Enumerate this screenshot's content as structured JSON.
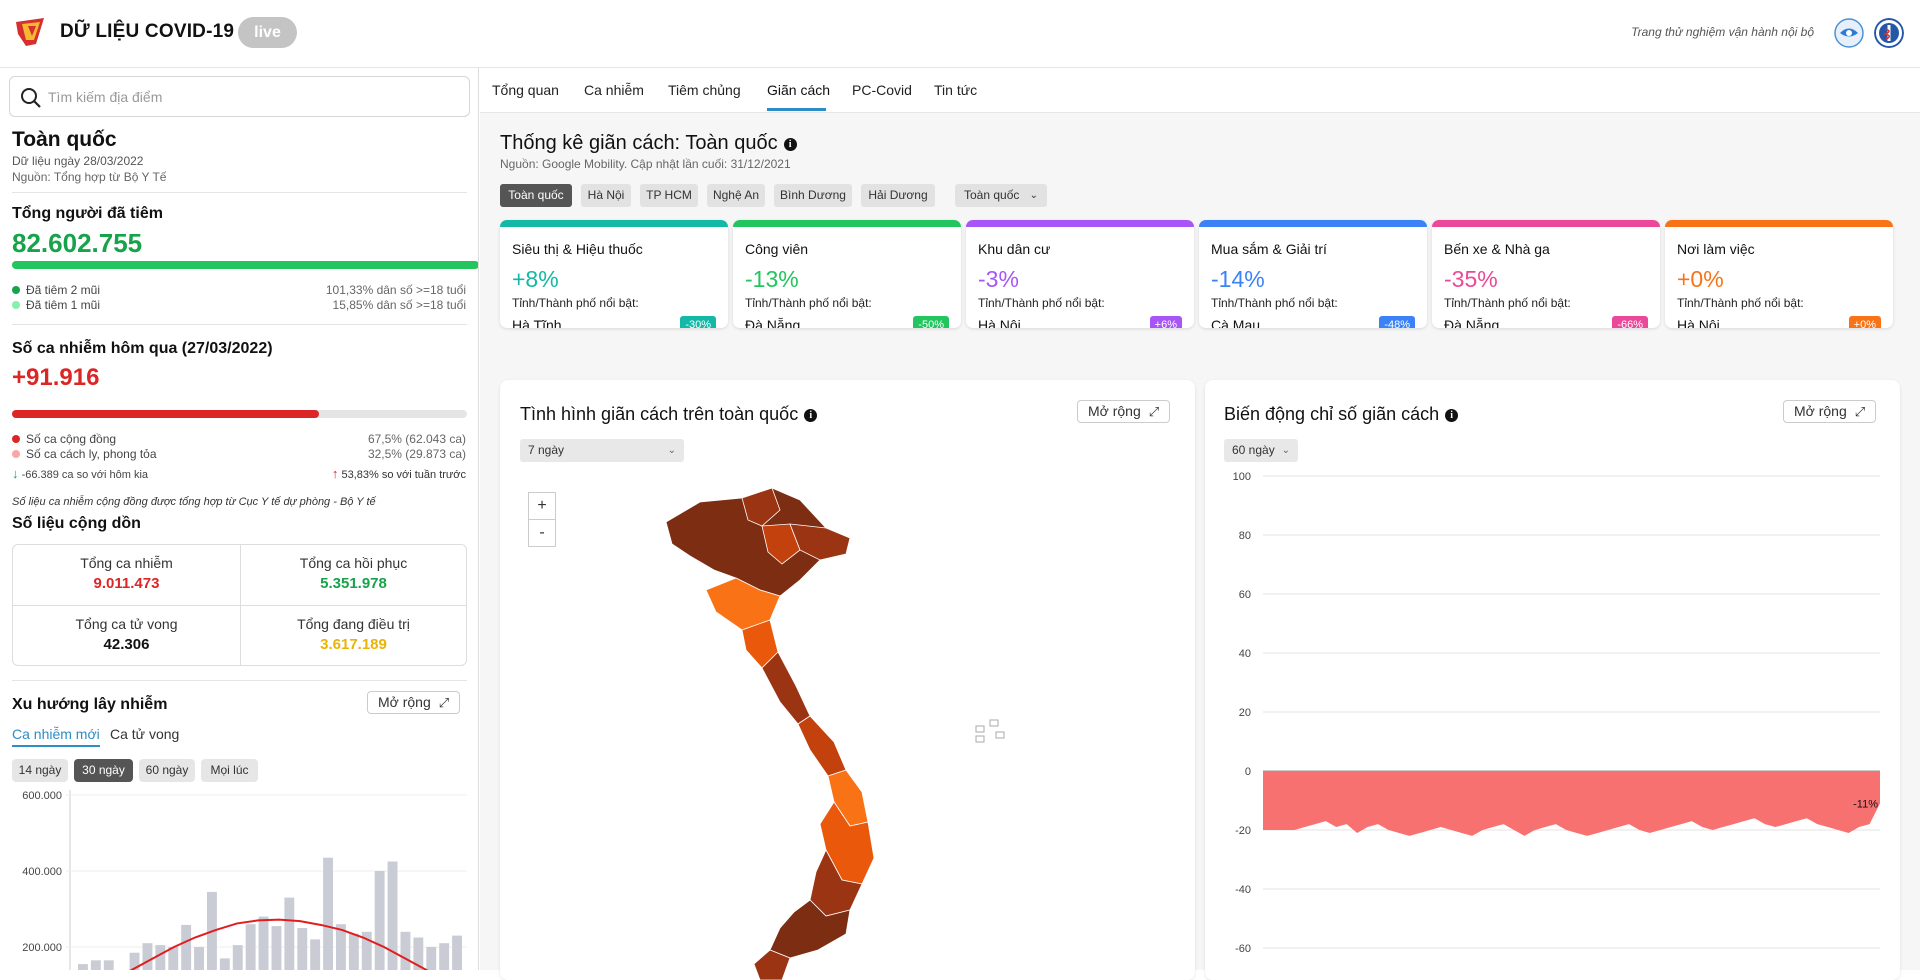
{
  "app": {
    "title": "DỮ LIỆU COVID-19",
    "live": "live",
    "notice": "Trang thử nghiệm vận hành nội bộ"
  },
  "sidebar": {
    "search_placeholder": "Tìm kiếm địa điểm",
    "region": "Toàn quốc",
    "data_date": "Dữ liệu ngày 28/03/2022",
    "data_source": "Nguồn: Tổng hợp từ Bộ Y Tế",
    "vax": {
      "title": "Tổng người đã tiêm",
      "value": "82.602.755",
      "dose2_label": "Đã tiêm 2 mũi",
      "dose2_value": "101,33% dân số >=18 tuổi",
      "dose1_label": "Đã tiêm 1 mũi",
      "dose1_value": "15,85% dân số >=18 tuổi",
      "progress": 1.0
    },
    "cases": {
      "title": "Số ca nhiễm hôm qua (27/03/2022)",
      "value": "+91.916",
      "progress": 0.675,
      "community_label": "Số ca cộng đồng",
      "community_value": "67,5% (62.043 ca)",
      "quarantine_label": "Số ca cách ly, phong tỏa",
      "quarantine_value": "32,5% (29.873 ca)",
      "vs_yesterday": "-66.389 ca so với hôm kia",
      "vs_lastweek": "53,83% so với tuần trước"
    },
    "note": "Số liệu ca nhiễm cộng đồng được tổng hợp từ Cục Y tế dự phòng - Bộ Y tế",
    "cumulative": {
      "title": "Số liệu cộng dồn",
      "total_cases_label": "Tổng ca nhiễm",
      "total_cases": "9.011.473",
      "recovered_label": "Tổng ca hồi phục",
      "recovered": "5.351.978",
      "deaths_label": "Tổng ca tử vong",
      "deaths": "42.306",
      "treating_label": "Tổng đang điều trị",
      "treating": "3.617.189"
    },
    "trend": {
      "title": "Xu hướng lây nhiễm",
      "expand": "Mở rộng",
      "tab_new": "Ca nhiễm mới",
      "tab_deaths": "Ca tử vong",
      "ranges": [
        "14 ngày",
        "30 ngày",
        "60 ngày",
        "Mọi lúc"
      ],
      "active_range": "30 ngày"
    }
  },
  "main": {
    "tabs": [
      "Tổng quan",
      "Ca nhiễm",
      "Tiêm chủng",
      "Giãn cách",
      "PC-Covid",
      "Tin tức"
    ],
    "active_tab": "Giãn cách",
    "title": "Thống kê giãn cách: Toàn quốc",
    "source": "Nguồn: Google Mobility. Cập nhật lần cuối: 31/12/2021",
    "regions": [
      "Toàn quốc",
      "Hà Nội",
      "TP HCM",
      "Nghệ An",
      "Bình Dương",
      "Hải Dương"
    ],
    "region_dropdown": "Toàn quốc",
    "cards": [
      {
        "title": "Siêu thị & Hiệu thuốc",
        "pct": "+8%",
        "label": "Tỉnh/Thành phố nổi bật:",
        "place": "Hà Tĩnh",
        "badge": "-30%",
        "color": "#14b8a6"
      },
      {
        "title": "Công viên",
        "pct": "-13%",
        "label": "Tỉnh/Thành phố nổi bật:",
        "place": "Đà Nẵng",
        "badge": "-50%",
        "color": "#22c55e"
      },
      {
        "title": "Khu dân cư",
        "pct": "-3%",
        "label": "Tỉnh/Thành phố nổi bật:",
        "place": "Hà Nội",
        "badge": "+6%",
        "color": "#a855f7"
      },
      {
        "title": "Mua sắm & Giải trí",
        "pct": "-14%",
        "label": "Tỉnh/Thành phố nổi bật:",
        "place": "Cà Mau",
        "badge": "-48%",
        "color": "#3b82f6"
      },
      {
        "title": "Bến xe & Nhà ga",
        "pct": "-35%",
        "label": "Tỉnh/Thành phố nổi bật:",
        "place": "Đà Nẵng",
        "badge": "-66%",
        "color": "#ec4899"
      },
      {
        "title": "Nơi làm việc",
        "pct": "+0%",
        "label": "Tỉnh/Thành phố nổi bật:",
        "place": "Hà Nội",
        "badge": "+0%",
        "color": "#f97316"
      }
    ],
    "map_panel": {
      "title": "Tình hình giãn cách trên toàn quốc",
      "expand": "Mở rộng",
      "range": "7 ngày",
      "zoom_in": "+",
      "zoom_out": "-"
    },
    "index_panel": {
      "title": "Biến động chỉ số giãn cách",
      "expand": "Mở rộng",
      "range": "60 ngày",
      "last_label": "-11%"
    }
  },
  "chart_data": [
    {
      "type": "bar",
      "title": "Xu hướng lây nhiễm",
      "yticks": [
        "600.000",
        "400.000",
        "200.000"
      ],
      "ylim": [
        0,
        600000
      ],
      "values": [
        155000,
        165000,
        165000,
        120000,
        185000,
        210000,
        205000,
        200000,
        258000,
        200000,
        345000,
        170000,
        205000,
        260000,
        280000,
        255000,
        330000,
        250000,
        220000,
        435000,
        260000,
        235000,
        240000,
        400000,
        425000,
        240000,
        225000,
        200000,
        210000,
        230000
      ],
      "series": [
        {
          "values": [
            80000,
            110000,
            140000,
            170000,
            200000,
            225000,
            245000,
            262000,
            270000,
            272000,
            268000,
            258000,
            245000,
            225000,
            200000,
            170000,
            140000,
            110000
          ]
        }
      ],
      "colors": {
        "bars": "#c9ccd4",
        "line": "#e11d1d"
      }
    },
    {
      "type": "area",
      "title": "Biến động chỉ số giãn cách",
      "yticks": [
        "100",
        "80",
        "60",
        "40",
        "20",
        "0",
        "-20",
        "-40",
        "-60"
      ],
      "ylim": [
        -60,
        100
      ],
      "values": [
        -20,
        -20,
        -20,
        -20,
        -19,
        -18,
        -17,
        -19,
        -18,
        -21,
        -19,
        -18,
        -20,
        -21,
        -22,
        -21,
        -20,
        -19,
        -20,
        -21,
        -22,
        -20,
        -19,
        -18,
        -20,
        -22,
        -20,
        -19,
        -18,
        -20,
        -21,
        -22,
        -21,
        -20,
        -19,
        -18,
        -20,
        -21,
        -20,
        -19,
        -18,
        -17,
        -19,
        -20,
        -19,
        -18,
        -17,
        -16,
        -18,
        -19,
        -18,
        -17,
        -16,
        -18,
        -19,
        -20,
        -21,
        -19,
        -18,
        -11
      ],
      "last_label": "-11%",
      "colors": {
        "fill": "#f87171"
      }
    }
  ]
}
